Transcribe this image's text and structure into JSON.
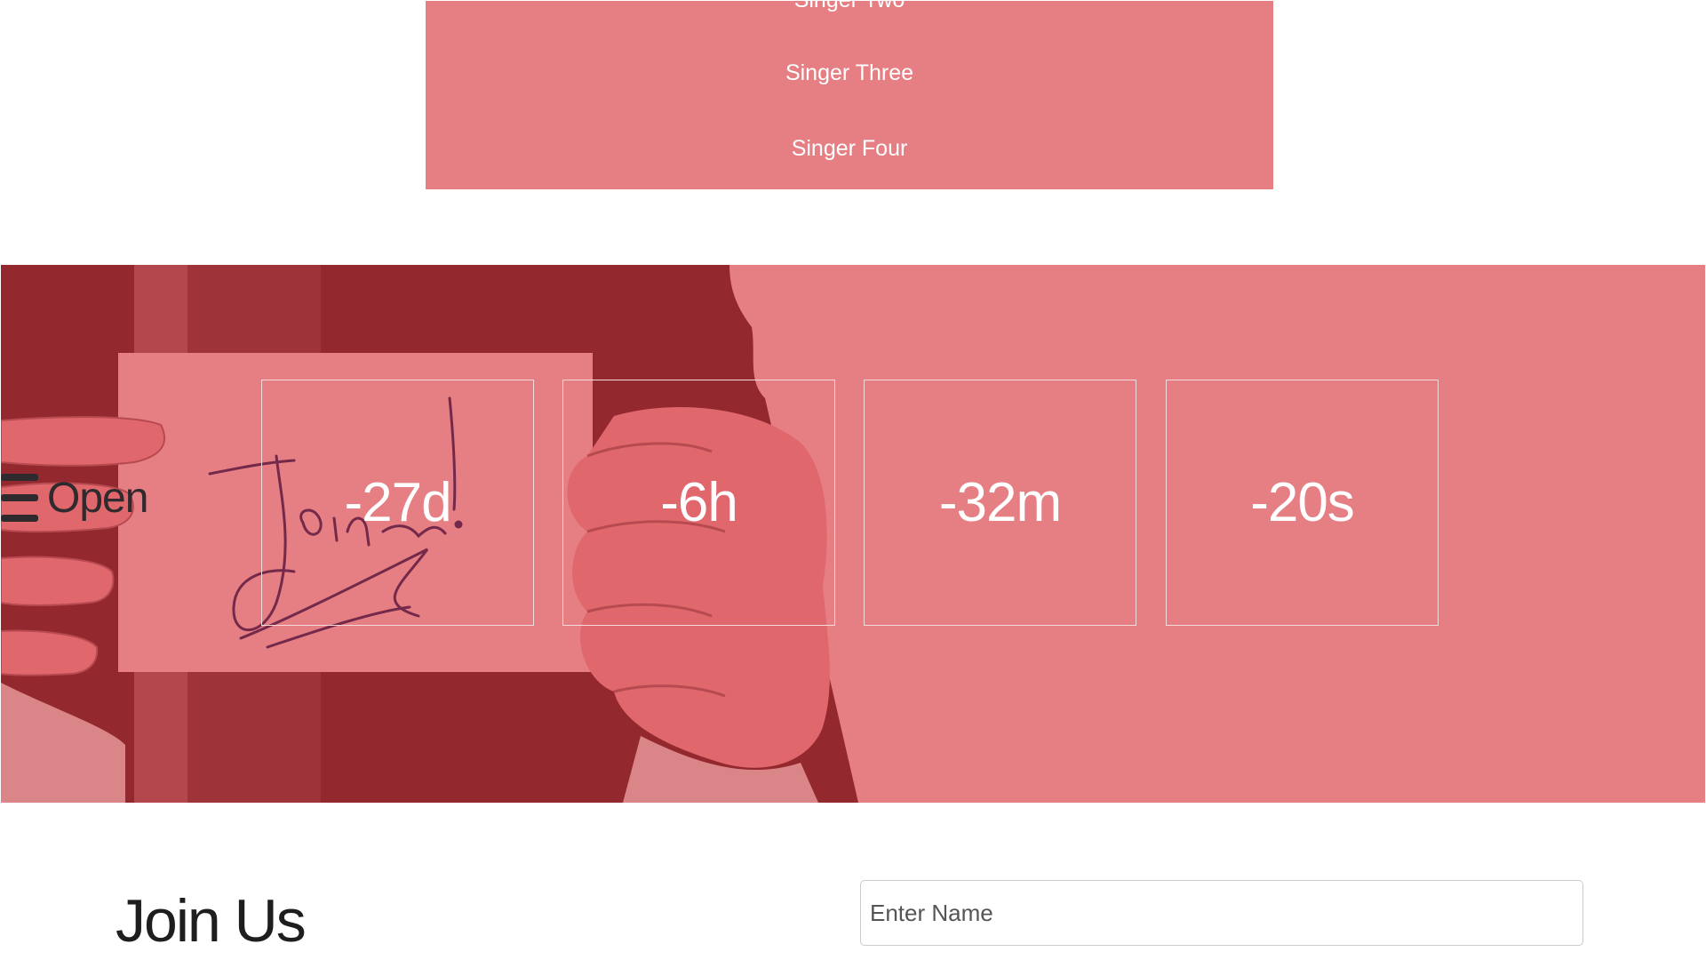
{
  "singers": {
    "items": [
      {
        "label": "Singer Two"
      },
      {
        "label": "Singer Three"
      },
      {
        "label": "Singer Four"
      }
    ],
    "background": "#e57f84"
  },
  "banner": {
    "background": "#e57f84",
    "photo_overlay_color": "#8d2129",
    "note_text": "Join us!",
    "toggle": {
      "icon": "hamburger-icon",
      "label": "Open"
    },
    "countdown": [
      {
        "value": "-27d"
      },
      {
        "value": "-6h"
      },
      {
        "value": "-32m"
      },
      {
        "value": "-20s"
      }
    ]
  },
  "join": {
    "title": "Join Us",
    "name_placeholder": "Enter Name"
  }
}
